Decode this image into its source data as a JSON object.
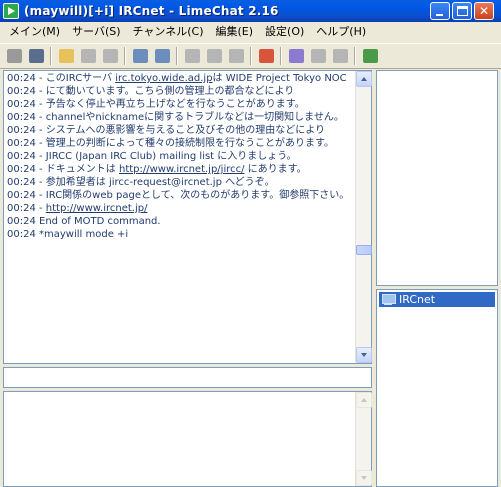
{
  "window": {
    "title": "(maywill)[+i] IRCnet - LimeChat 2.16"
  },
  "menu": [
    {
      "label": "メイン(M)"
    },
    {
      "label": "サーバ(S)"
    },
    {
      "label": "チャンネル(C)"
    },
    {
      "label": "編集(E)"
    },
    {
      "label": "設定(O)"
    },
    {
      "label": "ヘルプ(H)"
    }
  ],
  "toolbar": [
    {
      "icon": "connect-icon",
      "color": "#9a9a9a"
    },
    {
      "icon": "disconnect-icon",
      "color": "#5a6e8c"
    },
    {
      "sep": true
    },
    {
      "icon": "join-folder-icon",
      "color": "#e8c15a"
    },
    {
      "icon": "part-icon",
      "color": "#b5b5b5"
    },
    {
      "icon": "rejoin-icon",
      "color": "#b5b5b5"
    },
    {
      "sep": true
    },
    {
      "icon": "server-props-icon",
      "color": "#6d8ebd"
    },
    {
      "icon": "channel-props-icon",
      "color": "#6d8ebd"
    },
    {
      "sep": true
    },
    {
      "icon": "lock-icon",
      "color": "#b5b5b5"
    },
    {
      "icon": "key-icon",
      "color": "#b5b5b5"
    },
    {
      "icon": "ban-icon",
      "color": "#b5b5b5"
    },
    {
      "sep": true
    },
    {
      "icon": "checklist-icon",
      "color": "#d8553c"
    },
    {
      "sep": true
    },
    {
      "icon": "search-icon",
      "color": "#8a7bd0"
    },
    {
      "icon": "user-icon",
      "color": "#b5b5b5"
    },
    {
      "icon": "log-icon",
      "color": "#b5b5b5"
    },
    {
      "sep": true
    },
    {
      "icon": "exit-icon",
      "color": "#4a9a4a"
    }
  ],
  "log": [
    {
      "time": "00:24",
      "text": " - このIRCサーバ ",
      "link": "irc.tokyo.wide.ad.jp",
      "after": "は WIDE Project Tokyo NOC"
    },
    {
      "time": "00:24",
      "text": " -    にて動いています。こちら側の管理上の都合などにより"
    },
    {
      "time": "00:24",
      "text": " -    予告なく停止や再立ち上げなどを行なうことがあります。"
    },
    {
      "time": "00:24",
      "text": " -    channelやnicknameに関するトラブルなどは一切関知しません。"
    },
    {
      "time": "00:24",
      "text": " -    システムへの悪影響を与えること及びその他の理由などにより"
    },
    {
      "time": "00:24",
      "text": " -    管理上の判断によって種々の接続制限を行なうことがあります。"
    },
    {
      "time": "00:24",
      "text": " - JIRCC (Japan IRC Club) mailing list に入りましょう。"
    },
    {
      "time": "00:24",
      "text": " -    ドキュメントは ",
      "link": "http://www.ircnet.jp/jircc/",
      "after": " にあります。"
    },
    {
      "time": "00:24",
      "text": " -    参加希望者は jircc-request@ircnet.jp へどうぞ。"
    },
    {
      "time": "00:24",
      "text": " - IRC関係のweb pageとして、次のものがあります。御参照下さい。"
    },
    {
      "time": "00:24",
      "text": " -    ",
      "link": "http://www.ircnet.jp/",
      "after": ""
    },
    {
      "time": "00:24",
      "text": " End of MOTD command."
    },
    {
      "time": "00:24",
      "text": " *maywill mode +i"
    }
  ],
  "tree": {
    "server_label": "IRCnet"
  }
}
